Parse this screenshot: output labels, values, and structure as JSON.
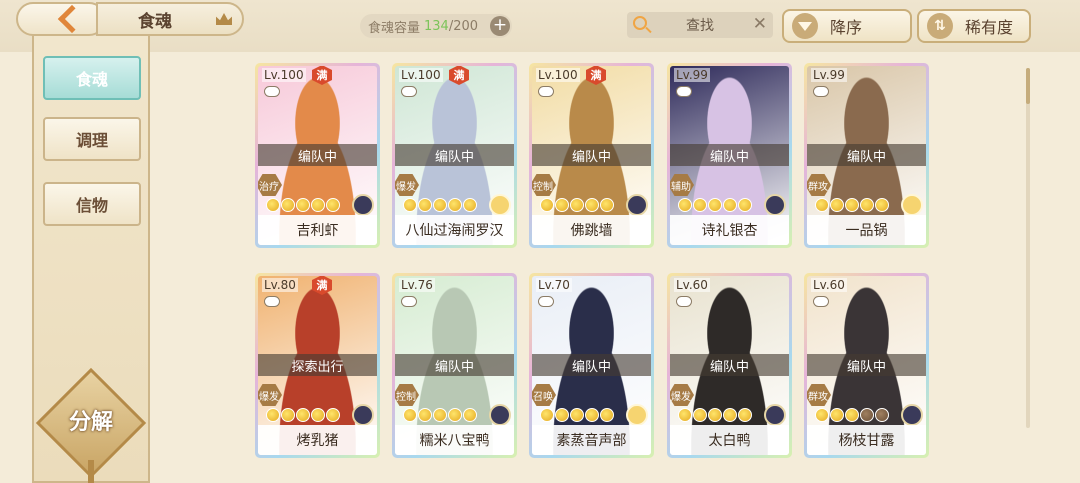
{
  "header": {
    "title": "食魂",
    "capacity_label": "食魂容量",
    "capacity_current": "134",
    "capacity_max": "/200",
    "capacity_add": "+",
    "search_placeholder": "查找",
    "search_clear": "✕",
    "sort_order": "降序",
    "sort_by": "稀有度"
  },
  "sidebar": {
    "tabs": [
      {
        "label": "食魂",
        "active": true
      },
      {
        "label": "调理",
        "active": false
      },
      {
        "label": "信物",
        "active": false
      }
    ],
    "decompose_label": "分解"
  },
  "cards": [
    {
      "level": "Lv.100",
      "full": "满",
      "status": "编队中",
      "role": "治疗",
      "stars": 5,
      "name": "吉利虾",
      "bg": "#f7c9d9",
      "accent": "#e38a4a"
    },
    {
      "level": "Lv.100",
      "full": "满",
      "status": "编队中",
      "role": "爆发",
      "stars": 5,
      "name": "八仙过海闹罗汉",
      "bg": "#cfe6d5",
      "accent": "#b9c3d8"
    },
    {
      "level": "Lv.100",
      "full": "满",
      "status": "编队中",
      "role": "控制",
      "stars": 5,
      "name": "佛跳墙",
      "bg": "#f2dca4",
      "accent": "#b98a4a"
    },
    {
      "level": "Lv.99",
      "full": "",
      "status": "编队中",
      "role": "辅助",
      "stars": 5,
      "name": "诗礼银杏",
      "bg": "#2e2a5a",
      "accent": "#d7c2e4"
    },
    {
      "level": "Lv.99",
      "full": "",
      "status": "编队中",
      "role": "群攻",
      "stars": 5,
      "name": "一品锅",
      "bg": "#d9c6a8",
      "accent": "#8a6a4e"
    },
    {
      "level": "Lv.80",
      "full": "满",
      "status": "探索出行",
      "role": "爆发",
      "stars": 5,
      "name": "烤乳猪",
      "bg": "#f0b270",
      "accent": "#b8402a"
    },
    {
      "level": "Lv.76",
      "full": "",
      "status": "编队中",
      "role": "控制",
      "stars": 5,
      "name": "糯米八宝鸭",
      "bg": "#d6ecd2",
      "accent": "#b8c8b4"
    },
    {
      "level": "Lv.70",
      "full": "",
      "status": "编队中",
      "role": "召唤",
      "stars": 5,
      "name": "素蒸音声部",
      "bg": "#e9eef6",
      "accent": "#2a2e4a"
    },
    {
      "level": "Lv.60",
      "full": "",
      "status": "编队中",
      "role": "爆发",
      "stars": 5,
      "name": "太白鸭",
      "bg": "#e8e2cf",
      "accent": "#2e2a28"
    },
    {
      "level": "Lv.60",
      "full": "",
      "status": "编队中",
      "role": "群攻",
      "stars": 3,
      "name": "杨枝甘露",
      "bg": "#f1e3cc",
      "accent": "#3a3436"
    }
  ],
  "colors": {
    "background": "#f4ecd9",
    "active_tab": "#a6dcd6",
    "capacity_highlight": "#7cc45a",
    "full_badge": "#d94a2c"
  }
}
